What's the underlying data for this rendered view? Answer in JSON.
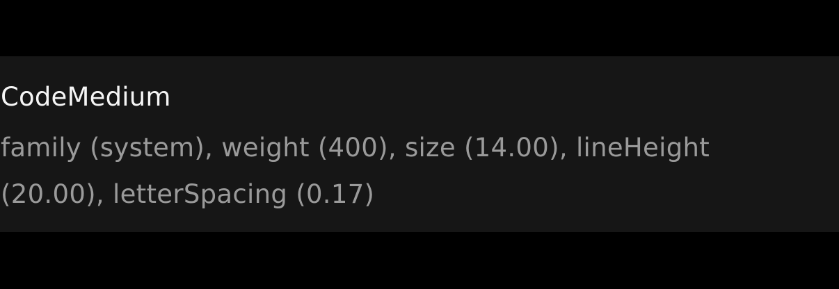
{
  "style_card": {
    "name": "CodeMedium",
    "description": "family (system), weight (400), size (14.00), lineHeight (20.00), letterSpacing (0.17)"
  },
  "colors": {
    "page_background": "#000000",
    "card_background": "#161616",
    "title_text": "#f5f5f5",
    "description_text": "#9a9a9a"
  }
}
